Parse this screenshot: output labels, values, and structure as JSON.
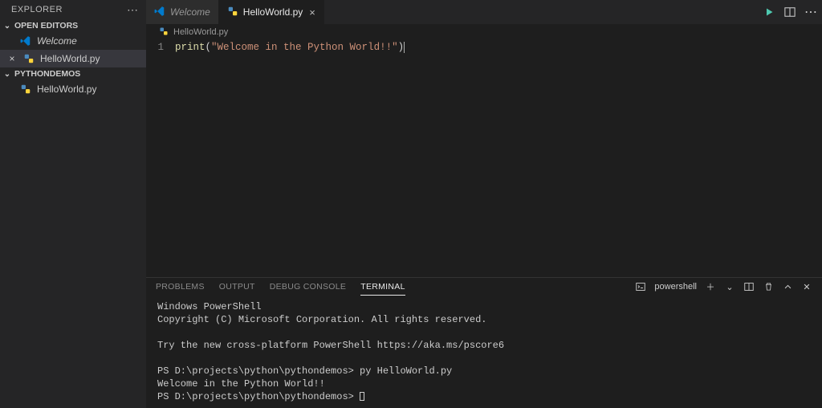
{
  "sidebar": {
    "title": "EXPLORER",
    "sections": {
      "openEditors": {
        "label": "OPEN EDITORS",
        "items": [
          {
            "label": "Welcome",
            "icon": "vscode",
            "italic": true
          },
          {
            "label": "HelloWorld.py",
            "icon": "python",
            "closeable": true,
            "selected": true
          }
        ]
      },
      "workspace": {
        "label": "PYTHONDEMOS",
        "items": [
          {
            "label": "HelloWorld.py",
            "icon": "python"
          }
        ]
      }
    }
  },
  "tabs": [
    {
      "label": "Welcome",
      "icon": "vscode",
      "italic": true,
      "active": false
    },
    {
      "label": "HelloWorld.py",
      "icon": "python",
      "active": true,
      "closeable": true
    }
  ],
  "breadcrumb": {
    "file": "HelloWorld.py"
  },
  "editor": {
    "line_number": "1",
    "code": {
      "fn": "print",
      "string": "\"Welcome in the Python World!!\""
    }
  },
  "panel": {
    "tabs": [
      "PROBLEMS",
      "OUTPUT",
      "DEBUG CONSOLE",
      "TERMINAL"
    ],
    "active_tab_index": 3,
    "right": {
      "shell": "powershell"
    },
    "terminal_lines": [
      "Windows PowerShell",
      "Copyright (C) Microsoft Corporation. All rights reserved.",
      "",
      "Try the new cross-platform PowerShell https://aka.ms/pscore6",
      "",
      "PS D:\\projects\\python\\pythondemos> py HelloWorld.py",
      "Welcome in the Python World!!",
      "PS D:\\projects\\python\\pythondemos> "
    ]
  }
}
